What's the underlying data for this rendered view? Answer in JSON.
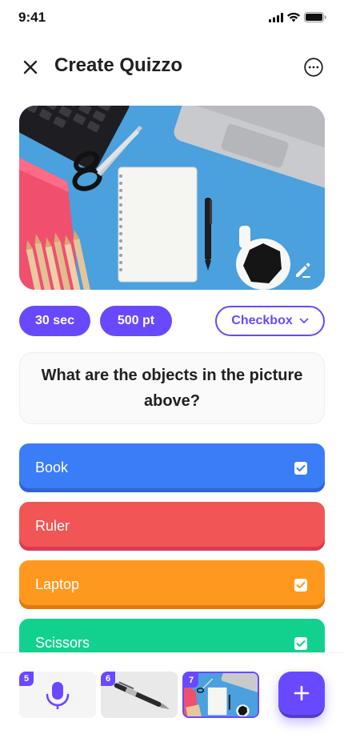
{
  "status_bar": {
    "time": "9:41"
  },
  "header": {
    "title": "Create Quizzo"
  },
  "chips": {
    "time_limit": "30 sec",
    "points": "500 pt",
    "answer_type": "Checkbox"
  },
  "question": {
    "text": "What are the objects in the picture above?"
  },
  "answers": [
    {
      "label": "Book",
      "checked": true,
      "color": "#3b7cf7",
      "shade": "#2f63d6"
    },
    {
      "label": "Ruler",
      "checked": false,
      "color": "#f25555",
      "shade": "#d93a55"
    },
    {
      "label": "Laptop",
      "checked": true,
      "color": "#ff981f",
      "shade": "#e07d0a"
    },
    {
      "label": "Scissors",
      "checked": true,
      "color": "#12d18e",
      "shade": "#0fb47a"
    }
  ],
  "slides": [
    {
      "number": "5",
      "icon": "microphone-icon"
    },
    {
      "number": "6",
      "icon": "pen-image"
    },
    {
      "number": "7",
      "icon": "desk-image"
    }
  ],
  "colors": {
    "primary": "#6949ff"
  }
}
